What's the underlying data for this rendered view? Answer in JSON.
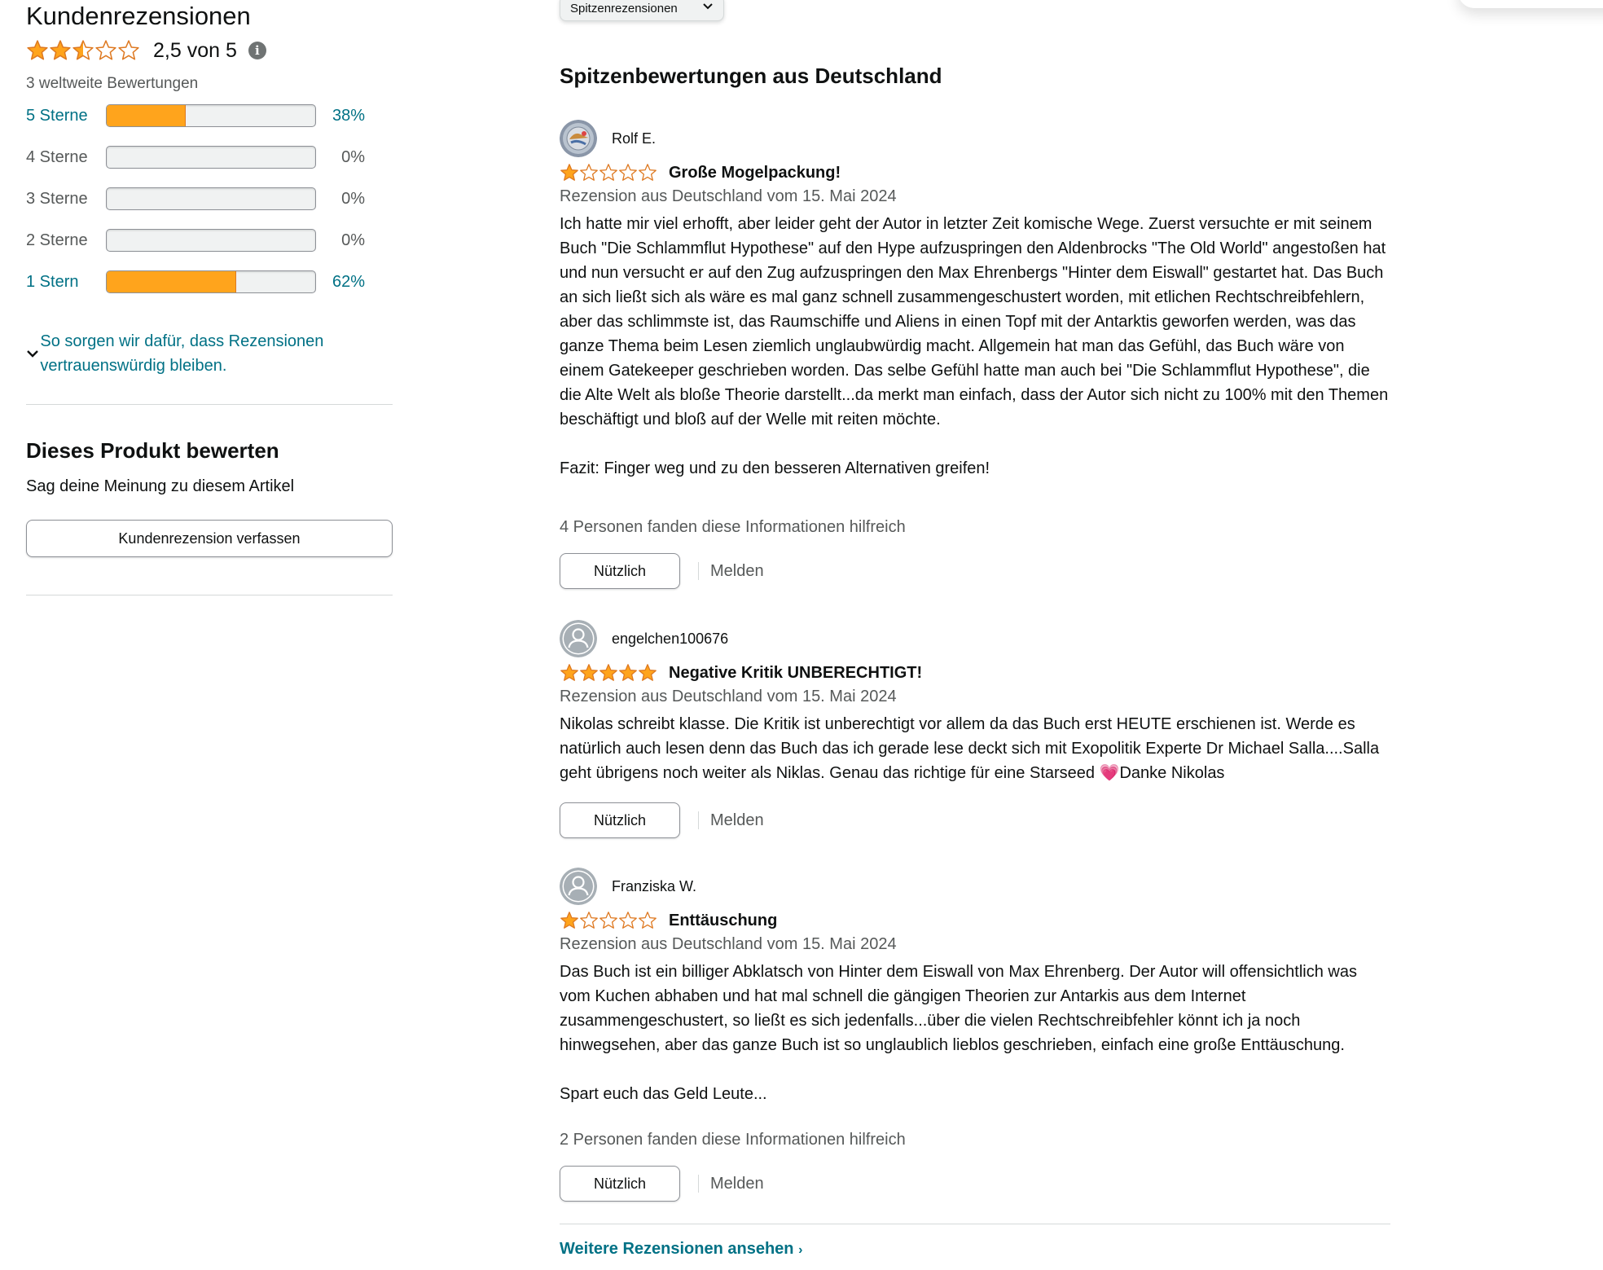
{
  "summary": {
    "title": "Kundenrezensionen",
    "average_rating": 2.5,
    "average_text": "2,5 von 5",
    "global_ratings": "3 weltweite Bewertungen",
    "histogram": [
      {
        "label": "5 Sterne",
        "percent_text": "38%",
        "fraction": 0.38,
        "link": true
      },
      {
        "label": "4 Sterne",
        "percent_text": "0%",
        "fraction": 0,
        "link": false
      },
      {
        "label": "3 Sterne",
        "percent_text": "0%",
        "fraction": 0,
        "link": false
      },
      {
        "label": "2 Sterne",
        "percent_text": "0%",
        "fraction": 0,
        "link": false
      },
      {
        "label": "1 Stern",
        "percent_text": "62%",
        "fraction": 0.62,
        "link": true
      }
    ],
    "trust_link": "So sorgen wir dafür, dass Rezensionen vertrauenswürdig bleiben."
  },
  "rate_product": {
    "title": "Dieses Produkt bewerten",
    "subtitle": "Sag deine Meinung zu diesem Artikel",
    "button": "Kundenrezension verfassen"
  },
  "sort": {
    "selected": "Spitzenrezensionen"
  },
  "section_title": "Spitzenbewertungen aus Deutschland",
  "reviews": [
    {
      "author": "Rolf E.",
      "avatar": "custom-photo",
      "rating": 1,
      "title": "Große Mogelpackung!",
      "date": "Rezension aus Deutschland vom 15. Mai 2024",
      "body": "Ich hatte mir viel erhofft, aber leider geht der Autor in letzter Zeit komische Wege. Zuerst versuchte er mit seinem Buch \"Die Schlammflut Hypothese\" auf den Hype aufzuspringen den Aldenbrocks \"The Old World\" angestoßen hat und nun versucht er auf den Zug aufzuspringen den Max Ehrenbergs \"Hinter dem Eiswall\" gestartet hat. Das Buch an sich ließt sich als wäre es mal ganz schnell zusammengeschustert worden, mit etlichen Rechtschreibfehlern, aber das schlimmste ist, das Raumschiffe und Aliens in einen Topf mit der Antarktis geworfen werden, was das ganze Thema beim Lesen ziemlich unglaubwürdig macht. Allgemein hat man das Gefühl, das Buch wäre von einem Gatekeeper geschrieben worden. Das selbe Gefühl hatte man auch bei \"Die Schlammflut Hypothese\", die die Alte Welt als bloße Theorie darstellt...da merkt man einfach, dass der Autor sich nicht zu 100% mit den Themen beschäftigt und bloß auf der Welle mit reiten möchte.\n\nFazit: Finger weg und zu den besseren Alternativen greifen!",
      "helpful": "4 Personen fanden diese Informationen hilfreich",
      "useful_label": "Nützlich",
      "report_label": "Melden"
    },
    {
      "author": "engelchen100676",
      "avatar": "default-person",
      "rating": 5,
      "title": "Negative Kritik UNBERECHTIGT!",
      "date": "Rezension aus Deutschland vom 15. Mai 2024",
      "body": "Nikolas schreibt klasse. Die Kritik ist unberechtigt vor allem da das Buch erst HEUTE erschienen ist. Werde es natürlich auch lesen denn das Buch das ich gerade lese deckt sich mit Exopolitik Experte Dr Michael Salla....Salla geht übrigens noch weiter als Niklas. Genau das richtige für eine Starseed 💗Danke Nikolas",
      "helpful": "",
      "useful_label": "Nützlich",
      "report_label": "Melden"
    },
    {
      "author": "Franziska W.",
      "avatar": "default-person",
      "rating": 1,
      "title": "Enttäuschung",
      "date": "Rezension aus Deutschland vom 15. Mai 2024",
      "body": "Das Buch ist ein billiger Abklatsch von Hinter dem Eiswall von Max Ehrenberg. Der Autor will offensichtlich was vom Kuchen abhaben und hat mal schnell die gängigen Theorien zur Antarkis aus dem Internet zusammengeschustert, so ließt es sich jedenfalls...über die vielen Rechtschreibfehler könnt ich ja noch hinwegsehen, aber das ganze Buch ist so unglaublich lieblos geschrieben, einfach eine große Enttäuschung.\n\nSpart euch das Geld Leute...",
      "helpful": "2 Personen fanden diese Informationen hilfreich",
      "useful_label": "Nützlich",
      "report_label": "Melden"
    }
  ],
  "more_reviews": "Weitere Rezensionen ansehen",
  "colors": {
    "star": "#ffa41c",
    "star_stroke": "#de7921",
    "link": "#007185",
    "muted": "#565959"
  }
}
